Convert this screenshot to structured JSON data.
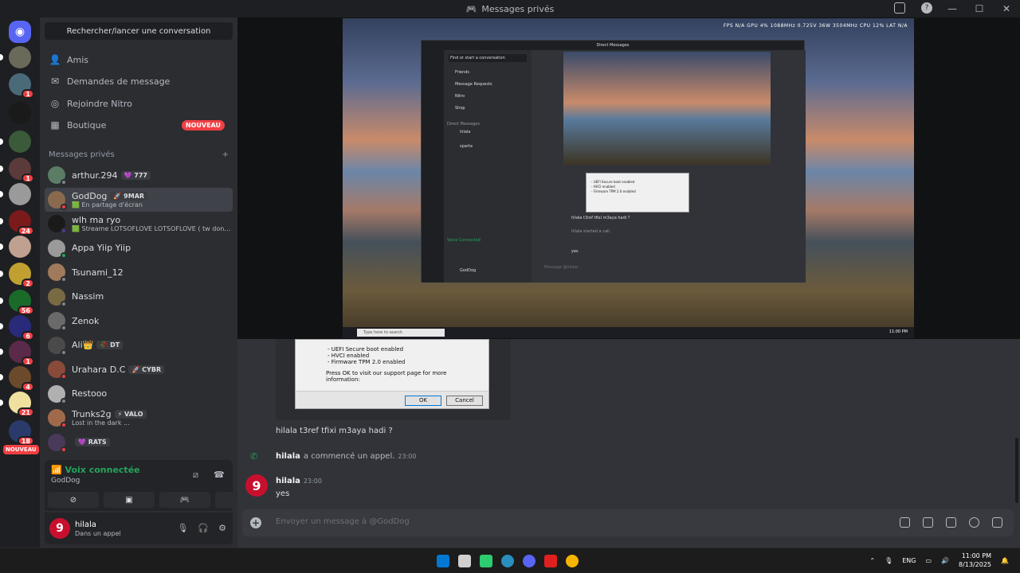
{
  "window": {
    "title": "Messages privés"
  },
  "guild_badges": [
    "1",
    "1",
    "24",
    "2",
    "56",
    "6",
    "1",
    "4",
    "21",
    "18"
  ],
  "guild_new": "NOUVEAU",
  "sidebar": {
    "search": "Rechercher/lancer une conversation",
    "nav": [
      {
        "label": "Amis",
        "icon": "friends-icon"
      },
      {
        "label": "Demandes de message",
        "icon": "mail-icon"
      },
      {
        "label": "Rejoindre Nitro",
        "icon": "nitro-icon"
      },
      {
        "label": "Boutique",
        "icon": "shop-icon",
        "badge": "NOUVEAU"
      }
    ],
    "section_title": "Messages privés",
    "dms": [
      {
        "name": "arthur.294",
        "tag": "💜 777",
        "sub": "",
        "color": "#5b7c65",
        "status": "offline"
      },
      {
        "name": "GodDog",
        "tag": "🚀 9MAR",
        "sub": "🟩 En partage d'écran",
        "color": "#8a6a4e",
        "status": "dnd",
        "active": true
      },
      {
        "name": "wlh ma ryo",
        "tag": "",
        "sub": "🟩 Streame LOTSOFLOVE LOTSOFLOVE ( tw dont j...",
        "color": "#1a1a1a",
        "status": "streaming"
      },
      {
        "name": "Appa Yiip Yiip",
        "tag": "",
        "sub": "",
        "color": "#9a9a9a",
        "status": "online"
      },
      {
        "name": "Tsunami_12",
        "tag": "",
        "sub": "",
        "color": "#a07a5a",
        "status": "offline"
      },
      {
        "name": "Nassim",
        "tag": "",
        "sub": "",
        "color": "#7a6a44",
        "status": "offline"
      },
      {
        "name": "Zenok",
        "tag": "",
        "sub": "",
        "color": "#6a6a6a",
        "status": "offline"
      },
      {
        "name": "Ali👑",
        "tag": "🥀 DT",
        "sub": "",
        "color": "#4a4a4a",
        "status": "offline"
      },
      {
        "name": "Urahara D.C",
        "tag": "🚀 CYBR",
        "sub": "",
        "color": "#8a4a3a",
        "status": "dnd"
      },
      {
        "name": "Restooo",
        "tag": "",
        "sub": "",
        "color": "#b0b0b0",
        "status": "offline"
      },
      {
        "name": "Trunks2g",
        "tag": "⚡ VALO",
        "sub": "Lost in the dark ...",
        "color": "#a06a4a",
        "status": "dnd"
      },
      {
        "name": "",
        "tag": "💜 RATS",
        "sub": "",
        "color": "#4a3a5a",
        "status": "dnd"
      }
    ]
  },
  "voice": {
    "status": "Voix connectée",
    "channel": "GodDog"
  },
  "user": {
    "name": "hilala",
    "status": "Dans un appel"
  },
  "stream": {
    "hud": "FPS N/A  GPU 4%  1088MHz 0.725V 36W 3504MHz  CPU 12%  LAT N/A",
    "inner_title": "Direct Messages",
    "inner_search": "Find or start a conversation",
    "inner_nav": [
      "Friends",
      "Message Requests",
      "Nitro",
      "Shop"
    ],
    "inner_section": "Direct Messages",
    "inner_dms": [
      "hilala",
      "sparta"
    ],
    "inner_msg": "hilala t3ref tfixi m3aya hadi ?",
    "inner_call": "hilala started a call.",
    "inner_yes": "yes",
    "inner_placeholder": "Message @hilala",
    "inner_voice": "Voice Connected",
    "inner_user": "GodDog",
    "search_text": "Type here to search",
    "clock": "11:00 PM"
  },
  "dialog": {
    "lines": [
      "- UEFI Secure boot enabled",
      "- HVCI enabled",
      "- Firmware TPM 2.0 enabled"
    ],
    "message": "Press OK to visit our support page for more information:",
    "ok": "OK",
    "cancel": "Cancel"
  },
  "chat": {
    "message1": "hilala t3ref tfixi m3aya hadi ?",
    "call_user": "hilala",
    "call_text": "a commencé un appel.",
    "call_time": "23:00",
    "post_user": "hilala",
    "post_time": "23:00",
    "post_text": "yes",
    "placeholder": "Envoyer un message à @GodDog"
  },
  "taskbar": {
    "lang": "ENG",
    "time": "11:00 PM",
    "date": "8/13/2025"
  }
}
